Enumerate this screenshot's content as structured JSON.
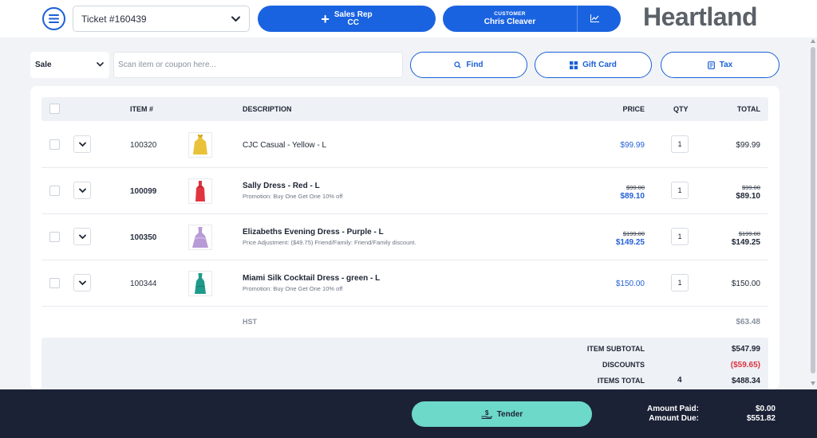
{
  "header": {
    "ticket_label": "Ticket #160439",
    "sales_rep_title": "Sales Rep",
    "sales_rep_value": "CC",
    "customer_caption": "CUSTOMER",
    "customer_name": "Chris Cleaver",
    "brand": "Heartland"
  },
  "toolbar": {
    "mode": "Sale",
    "scan_placeholder": "Scan item or coupon here...",
    "find_label": "Find",
    "gift_card_label": "Gift Card",
    "tax_label": "Tax"
  },
  "table": {
    "columns": {
      "item": "ITEM #",
      "description": "DESCRIPTION",
      "price": "PRICE",
      "qty": "QTY",
      "total": "TOTAL"
    },
    "rows": [
      {
        "item_no": "100320",
        "description": "CJC Casual - Yellow - L",
        "note": "",
        "price_original": "",
        "price": "$99.99",
        "qty": "1",
        "total_original": "",
        "total": "$99.99",
        "thumb_color": "#e9c23a"
      },
      {
        "item_no": "100099",
        "description": "Sally Dress - Red - L",
        "note": "Promotion: Buy One Get One 10% off",
        "price_original": "$99.00",
        "price": "$89.10",
        "qty": "1",
        "total_original": "$99.00",
        "total": "$89.10",
        "thumb_color": "#e0353f"
      },
      {
        "item_no": "100350",
        "description": "Elizabeths Evening Dress - Purple - L",
        "note": "Price Adjustment: ($49.75) Friend/Family: Friend/Family discount.",
        "price_original": "$199.00",
        "price": "$149.25",
        "qty": "1",
        "total_original": "$199.00",
        "total": "$149.25",
        "thumb_color": "#b89ad6"
      },
      {
        "item_no": "100344",
        "description": "Miami Silk Cocktail Dress - green - L",
        "note": "Promotion: Buy One Get One 10% off",
        "price_original": "",
        "price": "$150.00",
        "qty": "1",
        "total_original": "",
        "total": "$150.00",
        "thumb_color": "#1f9a8a"
      }
    ],
    "hst_label": "HST",
    "hst_value": "$63.48"
  },
  "summary": {
    "subtotal_label": "ITEM SUBTOTAL",
    "subtotal_value": "$547.99",
    "discounts_label": "DISCOUNTS",
    "discounts_value": "($59.65)",
    "items_total_label": "ITEMS TOTAL",
    "items_count": "4",
    "items_total_value": "$488.34"
  },
  "footer": {
    "tender_label": "Tender",
    "amount_paid_label": "Amount Paid:",
    "amount_paid_value": "$0.00",
    "amount_due_label": "Amount Due:",
    "amount_due_value": "$551.82"
  },
  "colors": {
    "accent_blue": "#1a63e0",
    "tender_teal": "#6dd9c8",
    "footer_navy": "#1b2236",
    "discount_red": "#d8333f"
  },
  "icons": [
    "menu-icon",
    "chevron-down-icon",
    "plus-icon",
    "chart-icon",
    "search-icon",
    "gift-card-icon",
    "receipt-icon",
    "dress-icon",
    "hand-money-icon"
  ]
}
